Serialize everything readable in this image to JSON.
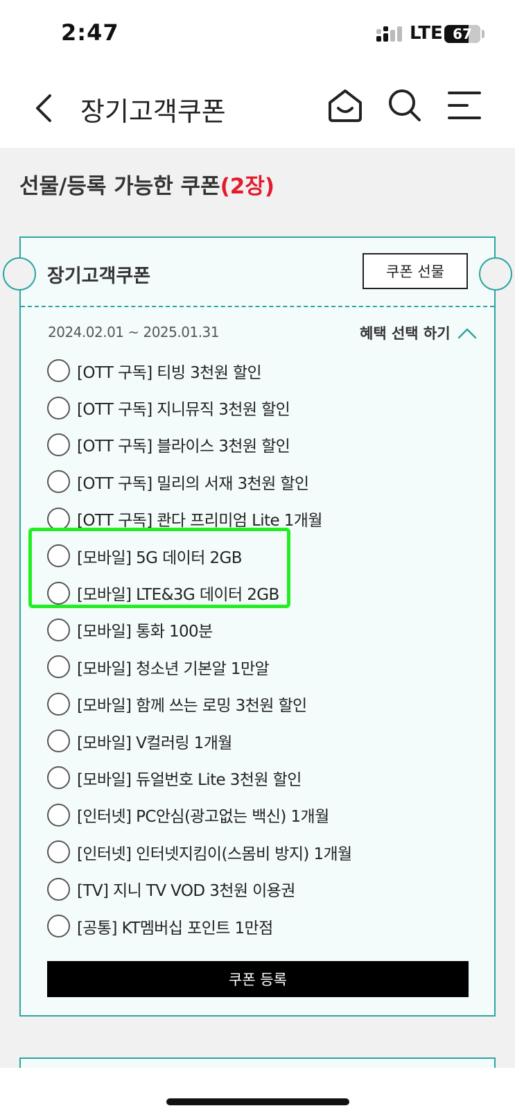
{
  "status_bar": {
    "time": "2:47",
    "network": "LTE",
    "battery": "67",
    "battery_level": 0.67
  },
  "header": {
    "title": "장기고객쿠폰",
    "icons": [
      "back-arrow-icon",
      "home-icon",
      "search-icon",
      "menu-icon"
    ]
  },
  "section": {
    "title": "선물/등록 가능한 쿠폰",
    "count": "(2장)"
  },
  "coupon": {
    "name": "장기고객쿠폰",
    "gift_label": "쿠폰 선물",
    "period": "2024.02.01 ~ 2025.01.31",
    "toggle_label": "혜택 선택 하기",
    "options": [
      "[OTT 구독] 티빙 3천원 할인",
      "[OTT 구독] 지니뮤직 3천원 할인",
      "[OTT 구독] 블라이스 3천원 할인",
      "[OTT 구독] 밀리의 서재 3천원 할인",
      "[OTT 구독] 콴다 프리미엄 Lite 1개월",
      "[모바일] 5G 데이터 2GB",
      "[모바일] LTE&3G 데이터 2GB",
      "[모바일] 통화 100분",
      "[모바일] 청소년 기본알 1만알",
      "[모바일] 함께 쓰는 로밍 3천원 할인",
      "[모바일] V컬러링 1개월",
      "[모바일] 듀얼번호 Lite 3천원 할인",
      "[인터넷] PC안심(광고없는 백신) 1개월",
      "[인터넷] 인터넷지킴이(스몸비 방지) 1개월",
      "[TV] 지니 TV VOD 3천원 이용권",
      "[공통] KT멤버십 포인트 1만점"
    ],
    "register_label": "쿠폰 등록"
  },
  "colors": {
    "accent_teal": "#2aa6a0",
    "count_red": "#e21b2d",
    "highlight_green": "#22ee22"
  }
}
